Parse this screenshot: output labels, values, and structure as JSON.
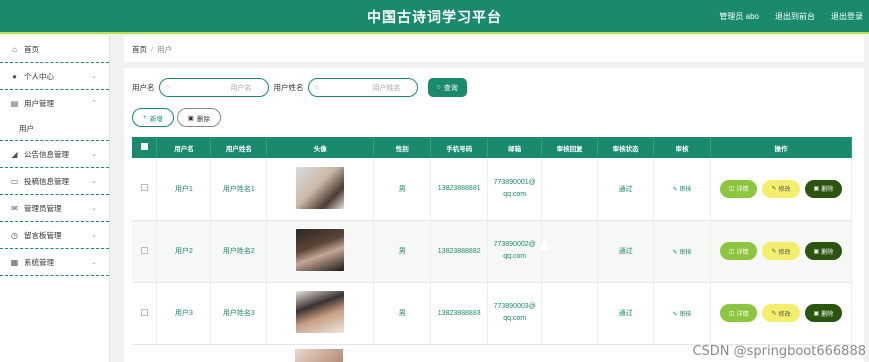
{
  "header": {
    "title": "中国古诗词学习平台",
    "admin_label": "管理员 abo",
    "back_label": "退出到前台",
    "logout_label": "退出登录"
  },
  "sidebar": {
    "items": [
      {
        "label": "首页",
        "icon": "home-icon",
        "chevron": false
      },
      {
        "label": "个人中心",
        "icon": "user-icon",
        "chevron": true
      },
      {
        "label": "用户管理",
        "icon": "users-icon",
        "chevron": true,
        "expanded": true
      },
      {
        "label": "公告信息管理",
        "icon": "megaphone-icon",
        "chevron": true
      },
      {
        "label": "投稿信息管理",
        "icon": "message-icon",
        "chevron": true
      },
      {
        "label": "管理员管理",
        "icon": "mail-icon",
        "chevron": true
      },
      {
        "label": "留言板管理",
        "icon": "clock-icon",
        "chevron": true
      },
      {
        "label": "系统管理",
        "icon": "list-icon",
        "chevron": true
      }
    ],
    "sub_item": "用户"
  },
  "breadcrumb": {
    "home": "首页",
    "separator": "/",
    "current": "用户"
  },
  "search": {
    "username_label": "用户名",
    "username_placeholder": "用户名",
    "fullname_label": "用户姓名",
    "fullname_placeholder": "用户姓名",
    "query_label": "查询"
  },
  "actions": {
    "add_label": "新增",
    "delete_label": "删除"
  },
  "table": {
    "headers": [
      "用户名",
      "用户姓名",
      "头像",
      "性别",
      "手机号码",
      "邮箱",
      "审核回复",
      "审核状态",
      "审核",
      "操作"
    ],
    "rows": [
      {
        "username": "用户1",
        "fullname": "用户姓名1",
        "gender": "男",
        "phone": "13823888881",
        "email1": "773890001@",
        "email2": "qq.com",
        "reply": "",
        "status": "通过",
        "audit": "审核"
      },
      {
        "username": "用户2",
        "fullname": "用户姓名2",
        "gender": "男",
        "phone": "13823888882",
        "email1": "773890002@",
        "email2": "qq.com",
        "reply": "",
        "status": "通过",
        "audit": "审核"
      },
      {
        "username": "用户3",
        "fullname": "用户姓名3",
        "gender": "男",
        "phone": "13823888883",
        "email1": "773890003@",
        "email2": "qq.com",
        "reply": "",
        "status": "通过",
        "audit": "审核"
      }
    ],
    "op_detail": "详情",
    "op_edit": "修改",
    "op_delete": "删除"
  },
  "watermark": "CSDN @springboot666888",
  "colors": {
    "primary": "#1a8a6e",
    "accent": "#b8e04a",
    "detail_btn": "#8cc63f",
    "edit_btn": "#f3ef6c",
    "delete_btn": "#2b5411"
  }
}
